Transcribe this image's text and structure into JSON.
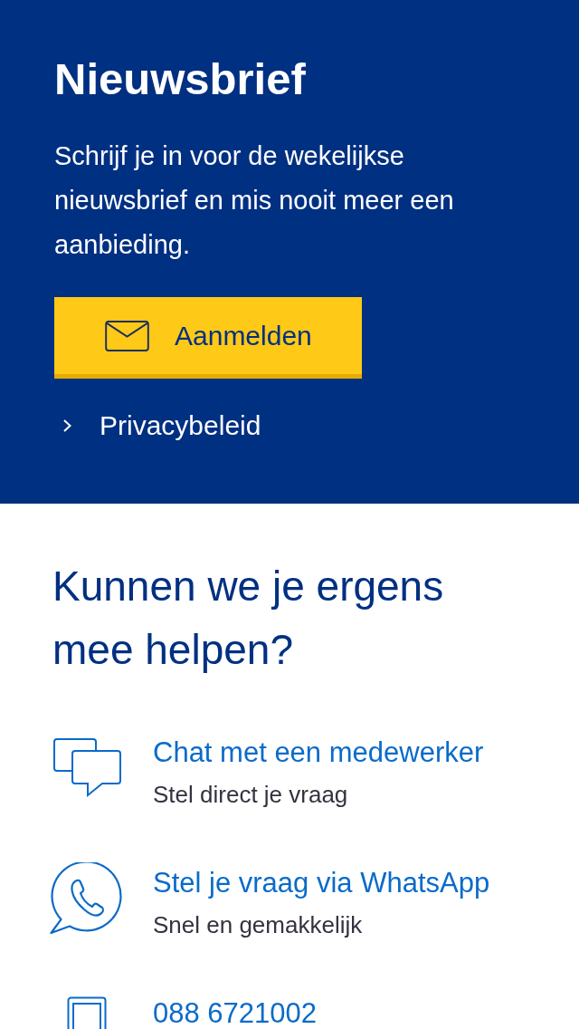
{
  "newsletter": {
    "title": "Nieuwsbrief",
    "text": "Schrijf je in voor de wekelijkse nieuwsbrief en mis nooit meer een aanbieding.",
    "button": {
      "label": "Aanmelden"
    },
    "link": {
      "label": "Privacybeleid"
    }
  },
  "help": {
    "title": "Kunnen we je ergens mee helpen?",
    "items": [
      {
        "kind": "chat",
        "title": "Chat met een medewerker",
        "subtitle": "Stel direct je vraag"
      },
      {
        "kind": "whatsapp",
        "title": "Stel je vraag via WhatsApp",
        "subtitle": "Snel en gemakkelijk"
      },
      {
        "kind": "phone",
        "title": "088 6721002"
      }
    ]
  }
}
